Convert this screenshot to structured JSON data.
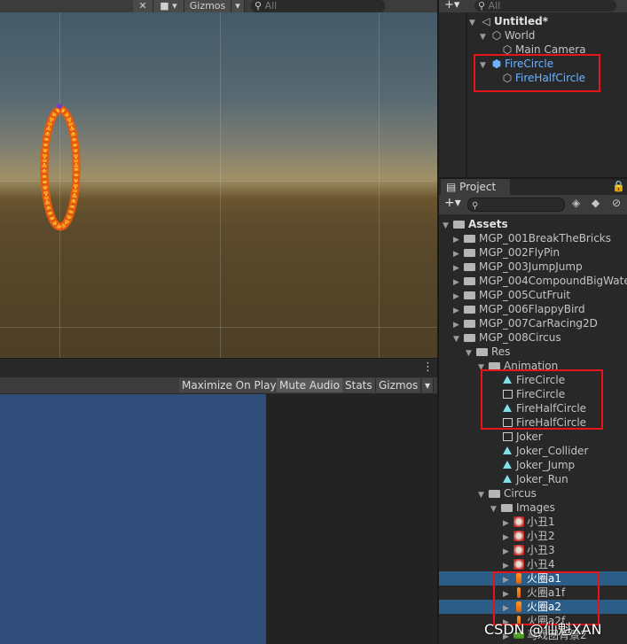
{
  "scene": {
    "toolbar": {
      "gizmos_label": "Gizmos",
      "search_placeholder": "All"
    }
  },
  "game": {
    "toolbar": {
      "maximize_label": "Maximize On Play",
      "mute_label": "Mute Audio",
      "stats_label": "Stats",
      "gizmos_label": "Gizmos"
    }
  },
  "hierarchy": {
    "search_placeholder": "All",
    "scene_name": "Untitled*",
    "items": [
      "World",
      "Main Camera",
      "FireCircle",
      "FireHalfCircle"
    ]
  },
  "project": {
    "tab_label": "Project",
    "root": "Assets",
    "folders": [
      "MGP_001BreakTheBricks",
      "MGP_002FlyPin",
      "MGP_003JumpJump",
      "MGP_004CompoundBigWate",
      "MGP_005CutFruit",
      "MGP_006FlappyBird",
      "MGP_007CarRacing2D",
      "MGP_008Circus"
    ],
    "res": "Res",
    "animation_folder": "Animation",
    "animation_items": [
      "FireCircle",
      "FireCircle",
      "FireHalfCircle",
      "FireHalfCircle",
      "Joker",
      "Joker_Collider",
      "Joker_Jump",
      "Joker_Run"
    ],
    "circus_folder": "Circus",
    "images_folder": "Images",
    "image_items": [
      "小丑1",
      "小丑2",
      "小丑3",
      "小丑4",
      "火圈a1",
      "火圈a1f",
      "火圈a2",
      "火圈a2f",
      "马戏团背景2"
    ]
  },
  "watermark": "CSDN @仙魁XAN",
  "colors": {
    "highlight_red": "#e8141c",
    "selection_blue": "#2c5d87",
    "game_background": "#314d79",
    "prefab_blue": "#6cb4ff"
  }
}
